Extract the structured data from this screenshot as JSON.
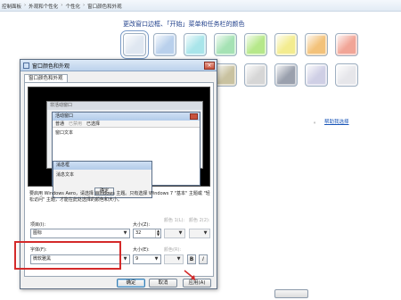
{
  "breadcrumb": [
    "控制面板",
    "外观和个性化",
    "个性化",
    "窗口颜色和外观"
  ],
  "background": {
    "heading": "更改窗口边框、「开始」菜单和任务栏的颜色",
    "link_fragment": "。",
    "link_text": "帮助我选择",
    "swatch_colors": [
      "#dfe7f1",
      "#b9d0ec",
      "#a9e5ea",
      "#a5e2b4",
      "#b6e88a",
      "#f3ec8f",
      "#f3c27a",
      "#f1a597",
      "#e7b9d4",
      "#d5cfe0",
      "#cbb4b9",
      "#c9c2a0",
      "#d6d6d6",
      "#9aa0ad",
      "#cfcfe5",
      "#e6e6ea"
    ]
  },
  "dialog": {
    "title": "窗口颜色和外观",
    "close_label": "×",
    "tab_label": "窗口颜色和外观",
    "preview": {
      "inactive_title": "非活动窗口",
      "active_title": "活动窗口",
      "menu": [
        "普通",
        "已禁用",
        "已选择"
      ],
      "window_text": "窗口文本",
      "msgbox_title": "消息框",
      "msgbox_text": "消息文本",
      "ok_label": "确定"
    },
    "description": "要启用 Windows Aero，请选择 Windows 主题。只有选择 Windows 7 \"基本\" 主题或 \"轻松访问\" 主题，才能在此处选择的颜色和大小。",
    "item": {
      "label": "项目(I):",
      "value": "图标",
      "size_label": "大小(Z):",
      "size_value": "32",
      "color1_label": "颜色 1(L):",
      "color2_label": "颜色 2(2):"
    },
    "font": {
      "label": "字体(F):",
      "value": "微软雅黑",
      "size_label": "大小(E):",
      "size_value": "9",
      "color_label": "颜色(R):",
      "bold": "B",
      "italic": "I"
    },
    "buttons": {
      "ok": "确定",
      "cancel": "取消",
      "apply": "应用(A)"
    }
  }
}
